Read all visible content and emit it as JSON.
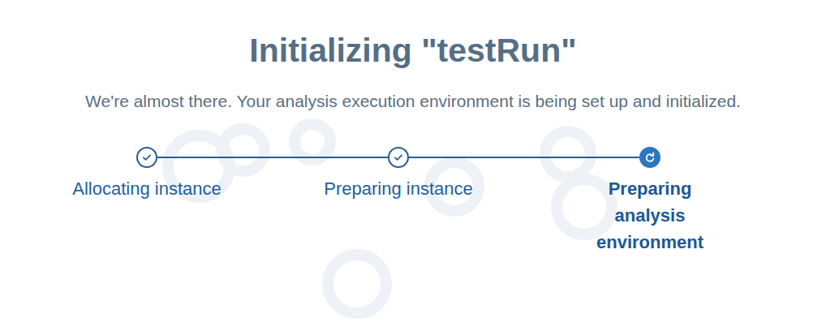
{
  "page": {
    "title": "Initializing \"testRun\"",
    "subtitle": "We're almost there. Your analysis execution environment is being set up and initialized."
  },
  "steps": [
    {
      "label": "Allocating instance",
      "done": true,
      "selected": false
    },
    {
      "label": "Preparing instance",
      "done": true,
      "selected": false
    },
    {
      "label": "Preparing analysis environment",
      "done": false,
      "selected": true
    }
  ]
}
